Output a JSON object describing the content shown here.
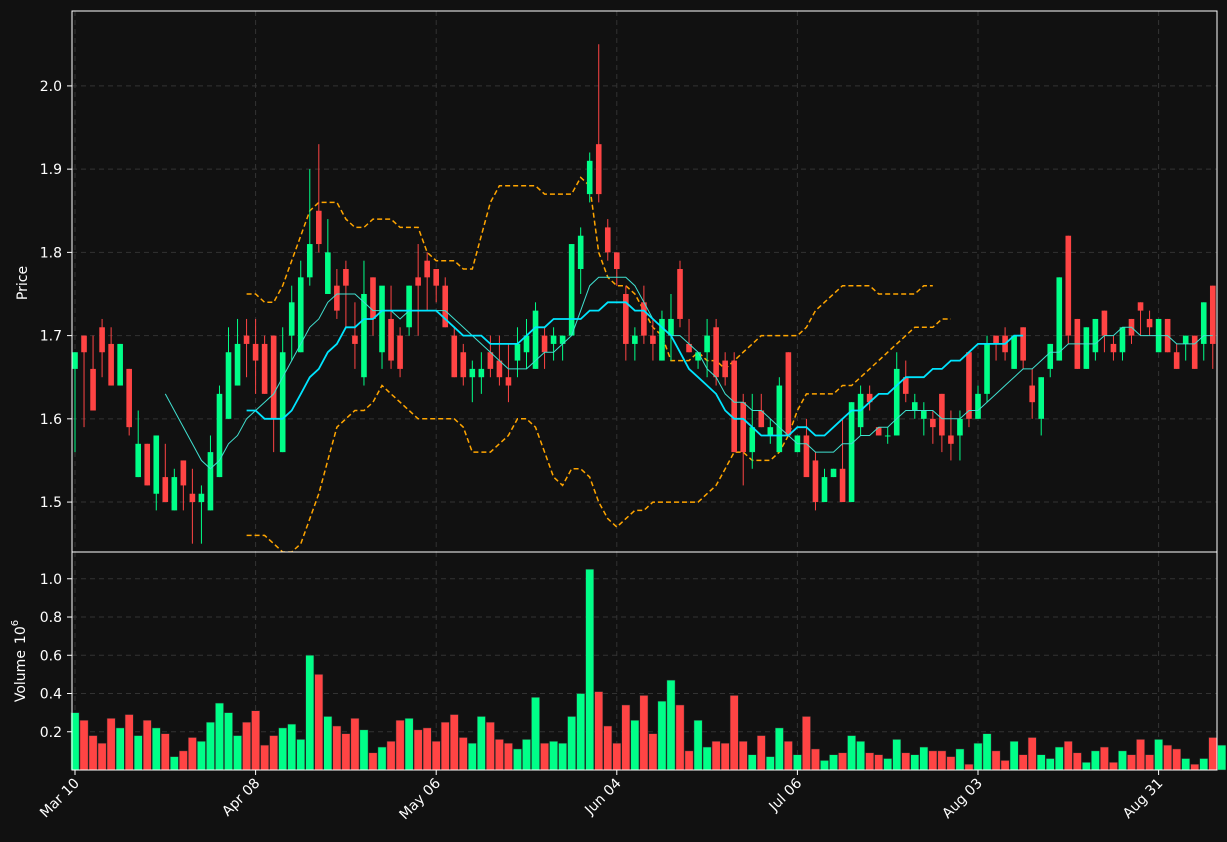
{
  "chart_data": {
    "type": "candlestick",
    "price_axis": {
      "label": "Price",
      "ticks": [
        1.5,
        1.6,
        1.7,
        1.8,
        1.9,
        2.0
      ],
      "tick_labels": [
        "1.5",
        "1.6",
        "1.7",
        "1.8",
        "1.9",
        "2.0"
      ],
      "ylim": [
        1.44,
        2.09
      ]
    },
    "volume_axis": {
      "label": "Volume",
      "exponent_label": "10",
      "exponent_power": "6",
      "ticks": [
        0.2,
        0.4,
        0.6,
        0.8,
        1.0
      ],
      "tick_labels": [
        "0.2",
        "0.4",
        "0.6",
        "0.8",
        "1.0"
      ],
      "ylim": [
        0,
        1.14
      ]
    },
    "x_axis": {
      "tick_labels": [
        "Mar 10",
        "Apr 08",
        "May 06",
        "Jun 04",
        "Jul 06",
        "Aug 03",
        "Aug 31"
      ],
      "tick_index": [
        0,
        20,
        40,
        60,
        80,
        100,
        120
      ]
    },
    "colors": {
      "background": "#111111",
      "up": "#00ff88",
      "down": "#ff4444",
      "ma_fast": "#40e0d0",
      "ma_slow": "#00e5ff",
      "bollinger": "#ffa500",
      "grid": "#333333",
      "frame": "#ffffff"
    },
    "grid": true,
    "ohlc": [
      [
        1.66,
        1.68,
        1.56,
        1.68
      ],
      [
        1.7,
        1.7,
        1.59,
        1.68
      ],
      [
        1.66,
        1.7,
        1.61,
        1.61
      ],
      [
        1.71,
        1.72,
        1.65,
        1.68
      ],
      [
        1.69,
        1.71,
        1.64,
        1.64
      ],
      [
        1.64,
        1.69,
        1.64,
        1.69
      ],
      [
        1.66,
        1.66,
        1.58,
        1.59
      ],
      [
        1.53,
        1.61,
        1.53,
        1.57
      ],
      [
        1.57,
        1.57,
        1.52,
        1.52
      ],
      [
        1.51,
        1.58,
        1.49,
        1.58
      ],
      [
        1.53,
        1.57,
        1.5,
        1.5
      ],
      [
        1.49,
        1.54,
        1.49,
        1.53
      ],
      [
        1.55,
        1.55,
        1.49,
        1.52
      ],
      [
        1.51,
        1.54,
        1.45,
        1.5
      ],
      [
        1.5,
        1.52,
        1.45,
        1.51
      ],
      [
        1.49,
        1.58,
        1.49,
        1.56
      ],
      [
        1.53,
        1.64,
        1.53,
        1.63
      ],
      [
        1.6,
        1.71,
        1.6,
        1.68
      ],
      [
        1.64,
        1.72,
        1.64,
        1.69
      ],
      [
        1.7,
        1.72,
        1.65,
        1.69
      ],
      [
        1.69,
        1.72,
        1.63,
        1.67
      ],
      [
        1.69,
        1.7,
        1.63,
        1.63
      ],
      [
        1.7,
        1.7,
        1.56,
        1.6
      ],
      [
        1.56,
        1.71,
        1.56,
        1.68
      ],
      [
        1.7,
        1.76,
        1.67,
        1.74
      ],
      [
        1.68,
        1.79,
        1.68,
        1.77
      ],
      [
        1.77,
        1.9,
        1.76,
        1.81
      ],
      [
        1.85,
        1.93,
        1.8,
        1.81
      ],
      [
        1.75,
        1.84,
        1.75,
        1.8
      ],
      [
        1.76,
        1.78,
        1.72,
        1.73
      ],
      [
        1.78,
        1.79,
        1.71,
        1.76
      ],
      [
        1.7,
        1.74,
        1.66,
        1.69
      ],
      [
        1.65,
        1.79,
        1.64,
        1.75
      ],
      [
        1.77,
        1.77,
        1.7,
        1.72
      ],
      [
        1.68,
        1.75,
        1.66,
        1.76
      ],
      [
        1.72,
        1.76,
        1.66,
        1.67
      ],
      [
        1.7,
        1.71,
        1.65,
        1.66
      ],
      [
        1.71,
        1.76,
        1.7,
        1.76
      ],
      [
        1.77,
        1.81,
        1.7,
        1.76
      ],
      [
        1.79,
        1.8,
        1.73,
        1.77
      ],
      [
        1.78,
        1.78,
        1.74,
        1.76
      ],
      [
        1.76,
        1.77,
        1.71,
        1.71
      ],
      [
        1.7,
        1.71,
        1.65,
        1.65
      ],
      [
        1.68,
        1.69,
        1.64,
        1.65
      ],
      [
        1.65,
        1.67,
        1.62,
        1.66
      ],
      [
        1.65,
        1.68,
        1.63,
        1.66
      ],
      [
        1.68,
        1.7,
        1.65,
        1.66
      ],
      [
        1.67,
        1.7,
        1.64,
        1.65
      ],
      [
        1.65,
        1.69,
        1.62,
        1.64
      ],
      [
        1.67,
        1.71,
        1.65,
        1.69
      ],
      [
        1.68,
        1.72,
        1.66,
        1.7
      ],
      [
        1.66,
        1.74,
        1.66,
        1.73
      ],
      [
        1.7,
        1.71,
        1.66,
        1.68
      ],
      [
        1.69,
        1.71,
        1.67,
        1.7
      ],
      [
        1.69,
        1.7,
        1.67,
        1.7
      ],
      [
        1.7,
        1.81,
        1.7,
        1.81
      ],
      [
        1.78,
        1.83,
        1.75,
        1.82
      ],
      [
        1.87,
        1.92,
        1.86,
        1.91
      ],
      [
        1.93,
        2.05,
        1.86,
        1.87
      ],
      [
        1.83,
        1.84,
        1.79,
        1.8
      ],
      [
        1.8,
        1.8,
        1.76,
        1.78
      ],
      [
        1.75,
        1.76,
        1.67,
        1.69
      ],
      [
        1.69,
        1.71,
        1.67,
        1.7
      ],
      [
        1.74,
        1.76,
        1.69,
        1.7
      ],
      [
        1.7,
        1.72,
        1.67,
        1.69
      ],
      [
        1.67,
        1.73,
        1.67,
        1.72
      ],
      [
        1.7,
        1.75,
        1.67,
        1.72
      ],
      [
        1.78,
        1.79,
        1.71,
        1.72
      ],
      [
        1.69,
        1.72,
        1.68,
        1.68
      ],
      [
        1.67,
        1.68,
        1.66,
        1.68
      ],
      [
        1.68,
        1.72,
        1.65,
        1.7
      ],
      [
        1.71,
        1.72,
        1.64,
        1.65
      ],
      [
        1.67,
        1.68,
        1.64,
        1.65
      ],
      [
        1.67,
        1.68,
        1.56,
        1.56
      ],
      [
        1.62,
        1.63,
        1.52,
        1.56
      ],
      [
        1.56,
        1.63,
        1.54,
        1.59
      ],
      [
        1.61,
        1.63,
        1.59,
        1.59
      ],
      [
        1.58,
        1.6,
        1.57,
        1.59
      ],
      [
        1.56,
        1.65,
        1.56,
        1.64
      ],
      [
        1.68,
        1.68,
        1.58,
        1.58
      ],
      [
        1.56,
        1.58,
        1.56,
        1.58
      ],
      [
        1.58,
        1.6,
        1.54,
        1.53
      ],
      [
        1.55,
        1.56,
        1.49,
        1.5
      ],
      [
        1.5,
        1.54,
        1.5,
        1.53
      ],
      [
        1.53,
        1.54,
        1.53,
        1.54
      ],
      [
        1.54,
        1.6,
        1.5,
        1.5
      ],
      [
        1.5,
        1.62,
        1.5,
        1.62
      ],
      [
        1.59,
        1.64,
        1.58,
        1.63
      ],
      [
        1.63,
        1.64,
        1.61,
        1.62
      ],
      [
        1.59,
        1.59,
        1.58,
        1.58
      ],
      [
        1.58,
        1.59,
        1.57,
        1.58
      ],
      [
        1.58,
        1.68,
        1.58,
        1.66
      ],
      [
        1.65,
        1.67,
        1.62,
        1.63
      ],
      [
        1.61,
        1.63,
        1.6,
        1.62
      ],
      [
        1.6,
        1.62,
        1.58,
        1.61
      ],
      [
        1.6,
        1.61,
        1.57,
        1.59
      ],
      [
        1.63,
        1.63,
        1.56,
        1.58
      ],
      [
        1.58,
        1.61,
        1.55,
        1.57
      ],
      [
        1.58,
        1.61,
        1.55,
        1.6
      ],
      [
        1.68,
        1.68,
        1.59,
        1.6
      ],
      [
        1.6,
        1.64,
        1.6,
        1.63
      ],
      [
        1.63,
        1.7,
        1.62,
        1.69
      ],
      [
        1.7,
        1.7,
        1.67,
        1.69
      ],
      [
        1.7,
        1.71,
        1.67,
        1.68
      ],
      [
        1.66,
        1.7,
        1.66,
        1.7
      ],
      [
        1.71,
        1.71,
        1.66,
        1.67
      ],
      [
        1.64,
        1.66,
        1.6,
        1.62
      ],
      [
        1.6,
        1.65,
        1.58,
        1.65
      ],
      [
        1.66,
        1.69,
        1.65,
        1.69
      ],
      [
        1.67,
        1.77,
        1.67,
        1.77
      ],
      [
        1.82,
        1.82,
        1.69,
        1.7
      ],
      [
        1.72,
        1.72,
        1.66,
        1.66
      ],
      [
        1.66,
        1.71,
        1.66,
        1.71
      ],
      [
        1.68,
        1.72,
        1.67,
        1.72
      ],
      [
        1.73,
        1.73,
        1.68,
        1.7
      ],
      [
        1.69,
        1.7,
        1.67,
        1.68
      ],
      [
        1.68,
        1.71,
        1.67,
        1.71
      ],
      [
        1.72,
        1.72,
        1.69,
        1.7
      ],
      [
        1.74,
        1.74,
        1.7,
        1.73
      ],
      [
        1.72,
        1.73,
        1.7,
        1.71
      ],
      [
        1.68,
        1.72,
        1.68,
        1.72
      ],
      [
        1.72,
        1.72,
        1.68,
        1.68
      ],
      [
        1.68,
        1.69,
        1.66,
        1.66
      ],
      [
        1.69,
        1.7,
        1.67,
        1.7
      ],
      [
        1.7,
        1.7,
        1.66,
        1.66
      ],
      [
        1.69,
        1.74,
        1.67,
        1.74
      ],
      [
        1.76,
        1.76,
        1.66,
        1.69
      ]
    ],
    "volume": [
      0.3,
      0.26,
      0.18,
      0.14,
      0.27,
      0.22,
      0.29,
      0.18,
      0.26,
      0.22,
      0.19,
      0.07,
      0.1,
      0.17,
      0.15,
      0.25,
      0.35,
      0.3,
      0.18,
      0.25,
      0.31,
      0.13,
      0.18,
      0.22,
      0.24,
      0.16,
      0.6,
      0.5,
      0.28,
      0.23,
      0.19,
      0.27,
      0.21,
      0.09,
      0.12,
      0.15,
      0.26,
      0.27,
      0.21,
      0.22,
      0.15,
      0.25,
      0.29,
      0.17,
      0.14,
      0.28,
      0.25,
      0.16,
      0.14,
      0.11,
      0.16,
      0.38,
      0.14,
      0.15,
      0.14,
      0.28,
      0.4,
      1.05,
      0.41,
      0.23,
      0.14,
      0.34,
      0.26,
      0.39,
      0.19,
      0.36,
      0.47,
      0.34,
      0.1,
      0.26,
      0.12,
      0.15,
      0.14,
      0.39,
      0.15,
      0.08,
      0.18,
      0.07,
      0.22,
      0.15,
      0.08,
      0.28,
      0.11,
      0.05,
      0.08,
      0.09,
      0.18,
      0.15,
      0.09,
      0.08,
      0.06,
      0.16,
      0.09,
      0.08,
      0.12,
      0.1,
      0.1,
      0.07,
      0.11,
      0.03,
      0.14,
      0.19,
      0.1,
      0.05,
      0.15,
      0.08,
      0.17,
      0.08,
      0.06,
      0.12,
      0.15,
      0.09,
      0.04,
      0.1,
      0.12,
      0.04,
      0.1,
      0.08,
      0.16,
      0.08,
      0.16,
      0.13,
      0.11,
      0.06,
      0.03,
      0.06,
      0.17,
      0.13
    ],
    "ma_fast": [
      null,
      null,
      null,
      null,
      null,
      null,
      null,
      null,
      null,
      null,
      1.63,
      1.61,
      1.59,
      1.57,
      1.55,
      1.54,
      1.55,
      1.57,
      1.58,
      1.6,
      1.61,
      1.62,
      1.63,
      1.65,
      1.67,
      1.69,
      1.71,
      1.72,
      1.74,
      1.75,
      1.75,
      1.75,
      1.74,
      1.73,
      1.73,
      1.73,
      1.72,
      1.73,
      1.73,
      1.73,
      1.73,
      1.73,
      1.72,
      1.71,
      1.7,
      1.69,
      1.68,
      1.67,
      1.66,
      1.66,
      1.66,
      1.67,
      1.68,
      1.68,
      1.69,
      1.7,
      1.73,
      1.76,
      1.77,
      1.77,
      1.77,
      1.77,
      1.76,
      1.74,
      1.72,
      1.71,
      1.7,
      1.7,
      1.69,
      1.68,
      1.66,
      1.65,
      1.63,
      1.62,
      1.62,
      1.61,
      1.61,
      1.6,
      1.59,
      1.58,
      1.57,
      1.57,
      1.56,
      1.56,
      1.56,
      1.57,
      1.57,
      1.58,
      1.58,
      1.59,
      1.59,
      1.6,
      1.61,
      1.61,
      1.61,
      1.61,
      1.6,
      1.6,
      1.6,
      1.61,
      1.61,
      1.62,
      1.63,
      1.64,
      1.65,
      1.66,
      1.66,
      1.67,
      1.68,
      1.68,
      1.69,
      1.69,
      1.69,
      1.69,
      1.7,
      1.7,
      1.71,
      1.71,
      1.7,
      1.7,
      1.7,
      1.7,
      1.69,
      1.69,
      1.69,
      1.7,
      1.7
    ],
    "ma_slow": [
      null,
      null,
      null,
      null,
      null,
      null,
      null,
      null,
      null,
      null,
      null,
      null,
      null,
      null,
      null,
      null,
      null,
      null,
      null,
      1.61,
      1.61,
      1.6,
      1.6,
      1.6,
      1.61,
      1.63,
      1.65,
      1.66,
      1.68,
      1.69,
      1.71,
      1.71,
      1.72,
      1.72,
      1.73,
      1.73,
      1.73,
      1.73,
      1.73,
      1.73,
      1.73,
      1.72,
      1.71,
      1.7,
      1.7,
      1.7,
      1.69,
      1.69,
      1.69,
      1.69,
      1.7,
      1.71,
      1.71,
      1.72,
      1.72,
      1.72,
      1.72,
      1.73,
      1.73,
      1.74,
      1.74,
      1.74,
      1.73,
      1.73,
      1.72,
      1.71,
      1.7,
      1.68,
      1.66,
      1.65,
      1.64,
      1.63,
      1.61,
      1.6,
      1.6,
      1.59,
      1.58,
      1.58,
      1.58,
      1.58,
      1.59,
      1.59,
      1.58,
      1.58,
      1.59,
      1.6,
      1.61,
      1.61,
      1.62,
      1.63,
      1.63,
      1.64,
      1.65,
      1.65,
      1.65,
      1.66,
      1.66,
      1.67,
      1.67,
      1.68,
      1.69,
      1.69,
      1.69,
      1.69,
      1.7,
      1.7
    ],
    "bb_upper": [
      null,
      null,
      null,
      null,
      null,
      null,
      null,
      null,
      null,
      null,
      null,
      null,
      null,
      null,
      null,
      null,
      null,
      null,
      null,
      1.75,
      1.75,
      1.74,
      1.74,
      1.76,
      1.79,
      1.82,
      1.85,
      1.86,
      1.86,
      1.86,
      1.84,
      1.83,
      1.83,
      1.84,
      1.84,
      1.84,
      1.83,
      1.83,
      1.83,
      1.8,
      1.79,
      1.79,
      1.79,
      1.78,
      1.78,
      1.82,
      1.86,
      1.88,
      1.88,
      1.88,
      1.88,
      1.88,
      1.87,
      1.87,
      1.87,
      1.87,
      1.89,
      1.88,
      1.8,
      1.77,
      1.76,
      1.76,
      1.75,
      1.73,
      1.71,
      1.7,
      1.67,
      1.67,
      1.67,
      1.68,
      1.67,
      1.67,
      1.66,
      1.67,
      1.68,
      1.69,
      1.7,
      1.7,
      1.7,
      1.7,
      1.7,
      1.71,
      1.73,
      1.74,
      1.75,
      1.76,
      1.76,
      1.76,
      1.76,
      1.75,
      1.75,
      1.75,
      1.75,
      1.75,
      1.76,
      1.76
    ],
    "bb_lower": [
      null,
      null,
      null,
      null,
      null,
      null,
      null,
      null,
      null,
      null,
      null,
      null,
      null,
      null,
      null,
      null,
      null,
      null,
      null,
      1.46,
      1.46,
      1.46,
      1.45,
      1.44,
      1.44,
      1.45,
      1.48,
      1.51,
      1.55,
      1.59,
      1.6,
      1.61,
      1.61,
      1.62,
      1.64,
      1.63,
      1.62,
      1.61,
      1.6,
      1.6,
      1.6,
      1.6,
      1.6,
      1.59,
      1.56,
      1.56,
      1.56,
      1.57,
      1.58,
      1.6,
      1.6,
      1.59,
      1.56,
      1.53,
      1.52,
      1.54,
      1.54,
      1.53,
      1.5,
      1.48,
      1.47,
      1.48,
      1.49,
      1.49,
      1.5,
      1.5,
      1.5,
      1.5,
      1.5,
      1.5,
      1.51,
      1.52,
      1.54,
      1.56,
      1.56,
      1.55,
      1.55,
      1.55,
      1.56,
      1.58,
      1.61,
      1.63,
      1.63,
      1.63,
      1.63,
      1.64,
      1.64,
      1.65,
      1.66,
      1.67,
      1.68,
      1.69,
      1.7,
      1.71,
      1.71,
      1.71,
      1.72,
      1.72
    ]
  }
}
